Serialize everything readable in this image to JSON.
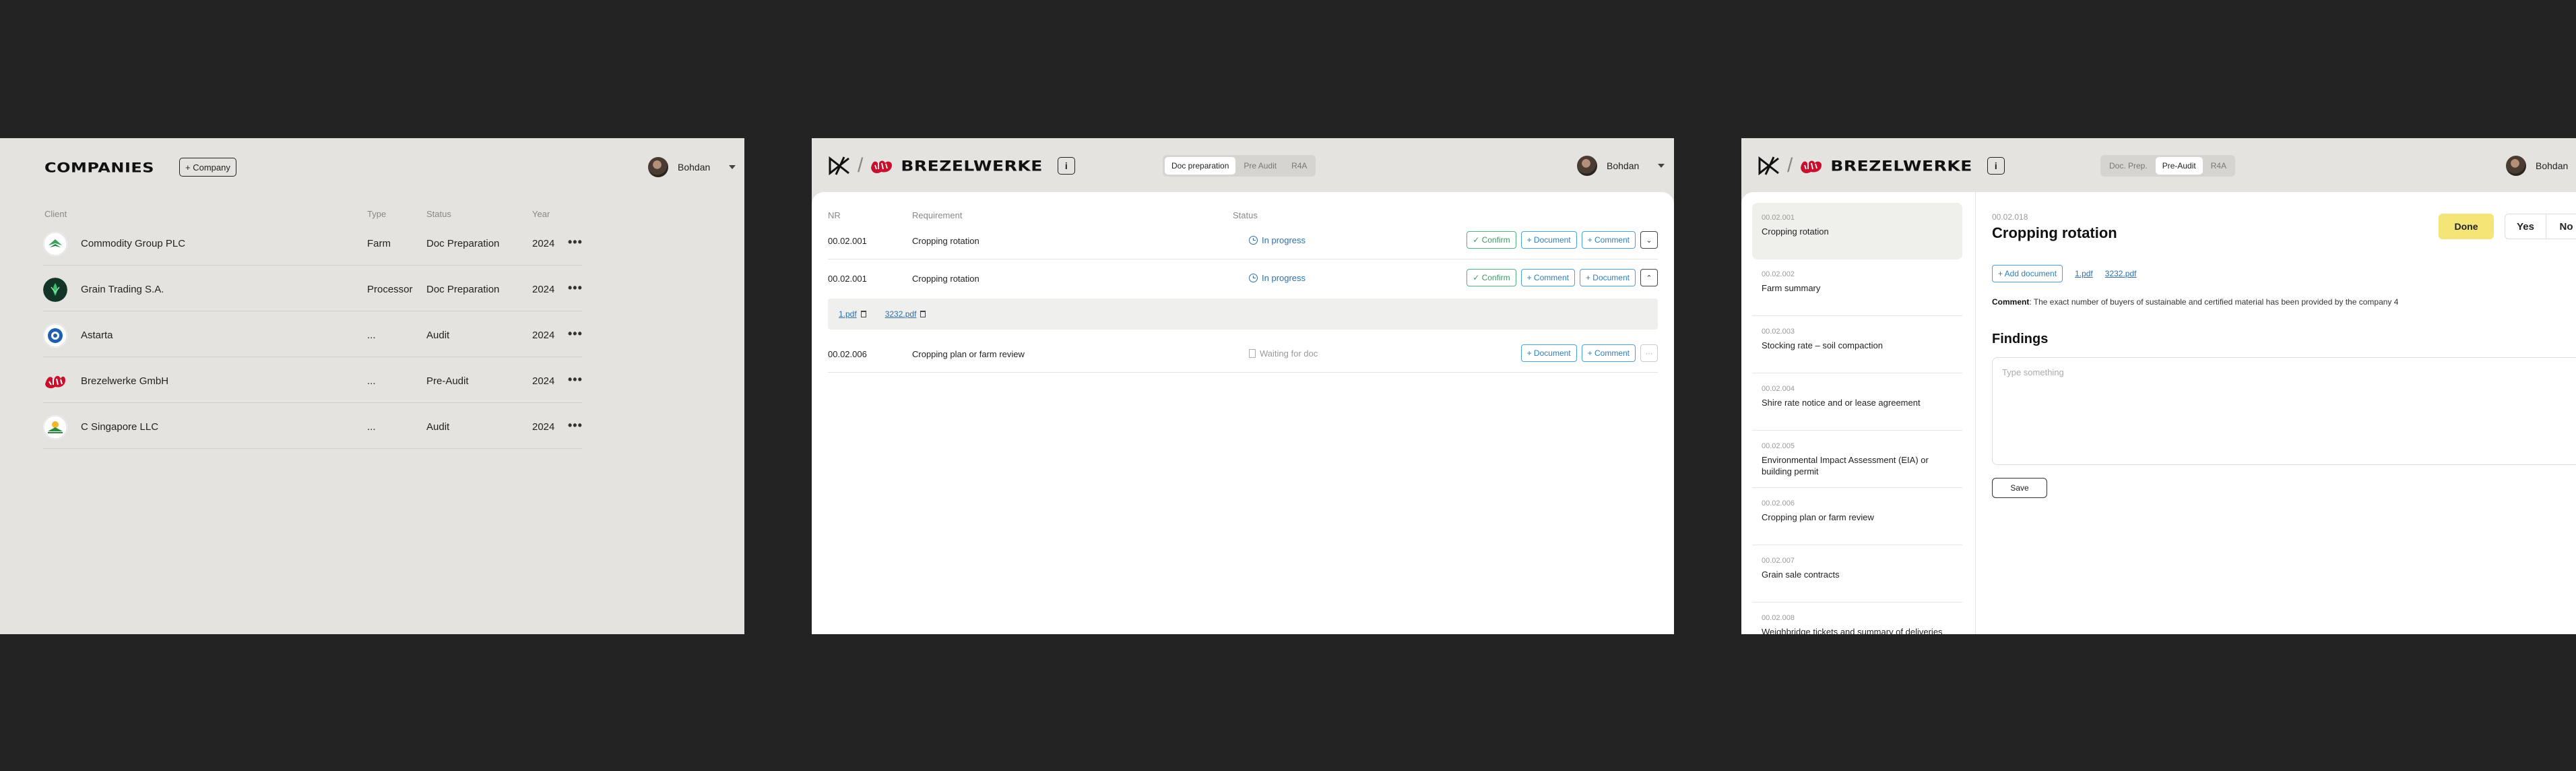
{
  "companies_screen": {
    "title": "COMPANIES",
    "add_button": "+ Company",
    "user": {
      "name": "Bohdan"
    },
    "columns": [
      "Client",
      "Type",
      "Status",
      "Year"
    ],
    "rows": [
      {
        "client": "Commodity Group PLC",
        "type": "Farm",
        "status": "Doc Preparation",
        "year": "2024",
        "more": "•••"
      },
      {
        "client": "Grain Trading S.A.",
        "type": "Processor",
        "status": "Doc Preparation",
        "year": "2024",
        "more": "•••"
      },
      {
        "client": "Astarta",
        "type": "...",
        "status": "Audit",
        "year": "2024",
        "more": "•••"
      },
      {
        "client": "Brezelwerke GmbH",
        "type": "...",
        "status": "Pre-Audit",
        "year": "2024",
        "more": "•••"
      },
      {
        "client": "C Singapore LLC",
        "type": "...",
        "status": "Audit",
        "year": "2024",
        "more": "•••"
      }
    ]
  },
  "docprep_screen": {
    "brand": {
      "name": "BREZELWERKE",
      "slash": "/",
      "info": "i"
    },
    "tabs": [
      "Doc preparation",
      "Pre Audit",
      "R4A"
    ],
    "user": {
      "name": "Bohdan"
    },
    "columns": {
      "nr": "NR",
      "requirement": "Requirement",
      "status": "Status"
    },
    "rows": [
      {
        "nr": "00.02.001",
        "requirement": "Cropping rotation",
        "status": "In progress",
        "actions": [
          "✓ Confirm",
          "+ Document",
          "+ Comment"
        ]
      },
      {
        "nr": "00.02.001",
        "requirement": "Cropping rotation",
        "status": "In progress",
        "actions": [
          "✓ Confirm",
          "+ Comment",
          "+ Document"
        ]
      },
      {
        "nr": "00.02.006",
        "requirement": "Cropping plan or farm review",
        "status": "Waiting for doc",
        "actions": [
          "+ Document",
          "+ Comment"
        ]
      }
    ],
    "files": [
      "1.pdf",
      "3232.pdf"
    ]
  },
  "preaudit_screen": {
    "brand": {
      "name": "BREZELWERKE",
      "slash": "/",
      "info": "i"
    },
    "tabs": [
      "Doc. Prep.",
      "Pre-Audit",
      "R4A"
    ],
    "user": {
      "name": "Bohdan"
    },
    "requirements": [
      {
        "nr": "00.02.001",
        "name": "Cropping rotation"
      },
      {
        "nr": "00.02.002",
        "name": "Farm summary"
      },
      {
        "nr": "00.02.003",
        "name": "Stocking rate – soil compaction"
      },
      {
        "nr": "00.02.004",
        "name": "Shire rate notice and or lease agreement"
      },
      {
        "nr": "00.02.005",
        "name": "Environmental Impact Assessment (EIA) or building permit"
      },
      {
        "nr": "00.02.006",
        "name": "Cropping plan or farm review"
      },
      {
        "nr": "00.02.007",
        "name": "Grain sale contracts"
      },
      {
        "nr": "00.02.008",
        "name": "Weighbridge tickets and summary of deliveries"
      }
    ],
    "detail": {
      "nr": "00.02.018",
      "title": "Cropping rotation",
      "done": "Done",
      "yes": "Yes",
      "no": "No",
      "add_document": "+ Add document",
      "files": [
        "1.pdf",
        "3232.pdf"
      ],
      "comment_label": "Comment",
      "comment_text": ": The exact number of buyers of sustainable and certified material has been provided by the company 4",
      "findings": "Findings",
      "placeholder": "Type something",
      "save": "Save"
    }
  },
  "colors": {
    "background": "#232323",
    "panel": "#e4e3df",
    "accent_blue": "#2f7fb8",
    "accent_green": "#3e9a63",
    "done_yellow": "#f5e577"
  }
}
